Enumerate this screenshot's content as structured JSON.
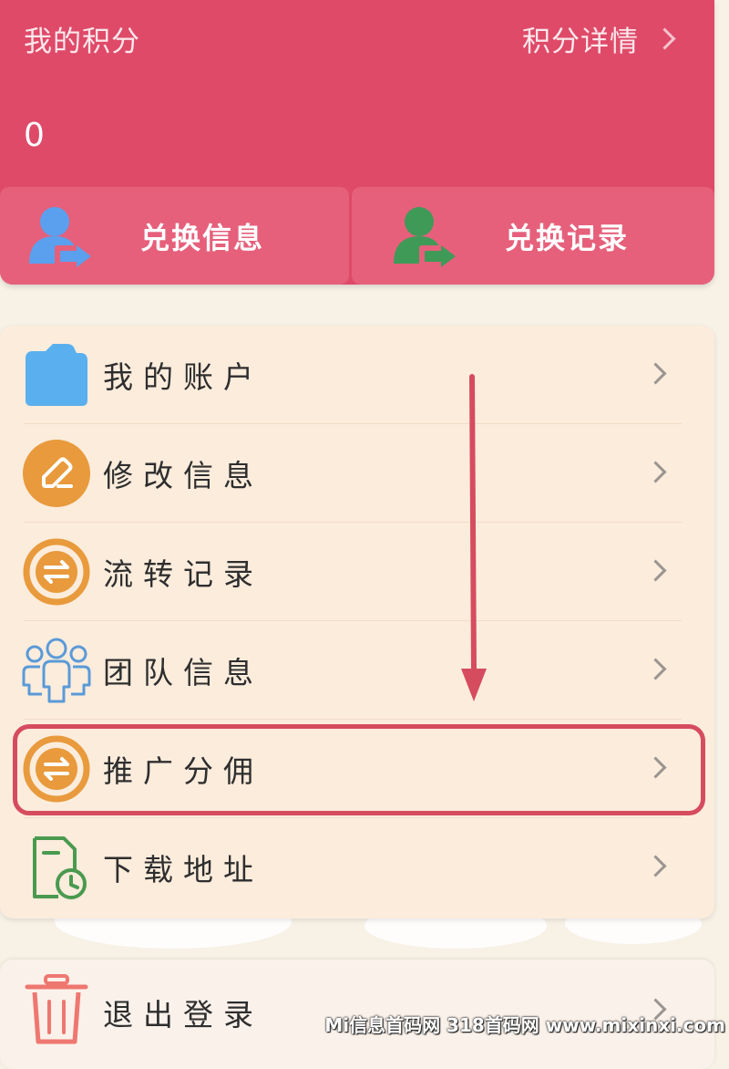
{
  "points": {
    "title": "我的积分",
    "detail_link": "积分详情",
    "value": "0"
  },
  "actions": [
    {
      "label": "兑换信息",
      "icon": "user-transfer-icon",
      "color": "#5aa0ee"
    },
    {
      "label": "兑换记录",
      "icon": "user-transfer-icon",
      "color": "#3f9a57"
    }
  ],
  "menu": {
    "items": [
      {
        "label": "我的账户",
        "icon": "folder-icon"
      },
      {
        "label": "修改信息",
        "icon": "edit-icon"
      },
      {
        "label": "流转记录",
        "icon": "transfer-icon"
      },
      {
        "label": "团队信息",
        "icon": "team-icon"
      },
      {
        "label": "推广分佣",
        "icon": "transfer-icon"
      },
      {
        "label": "下载地址",
        "icon": "document-clock-icon"
      }
    ]
  },
  "logout": {
    "label": "退出登录",
    "icon": "trash-icon"
  },
  "colors": {
    "header_bg": "#df4a69",
    "menu_bg": "#fcecdc",
    "highlight": "#d64c5f",
    "orange_icon": "#e89a3c",
    "blue_icon": "#5ab0ee",
    "green_icon": "#4a9a4f"
  },
  "watermark": "Mi信息首码网 318首码网 www.mixinxi.com"
}
